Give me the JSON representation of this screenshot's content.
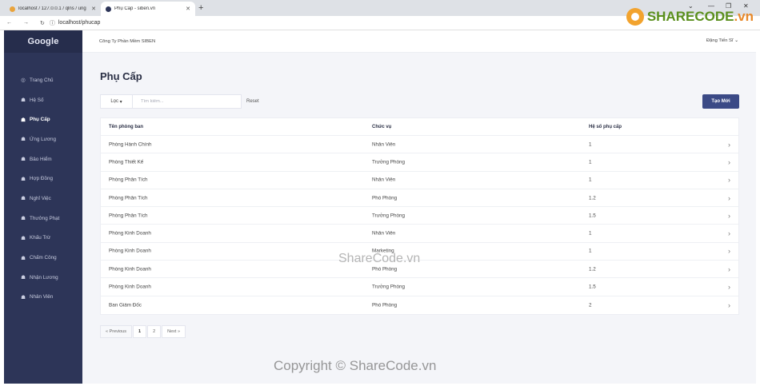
{
  "browser": {
    "tabs": [
      {
        "title": "localhost / 127.0.0.1 / qlns / ung"
      },
      {
        "title": "Phụ Cấp - siben.vn"
      }
    ],
    "new_tab": "+",
    "url": "localhost/phucap"
  },
  "sidebar": {
    "logo": "Google",
    "items": [
      {
        "label": "Trang Chủ"
      },
      {
        "label": "Hệ Số"
      },
      {
        "label": "Phụ Cấp"
      },
      {
        "label": "Ứng Lương"
      },
      {
        "label": "Bảo Hiểm"
      },
      {
        "label": "Hợp Đồng"
      },
      {
        "label": "Nghỉ Việc"
      },
      {
        "label": "Thưởng Phạt"
      },
      {
        "label": "Khấu Trừ"
      },
      {
        "label": "Chấm Công"
      },
      {
        "label": "Nhận Lương"
      },
      {
        "label": "Nhân Viên"
      }
    ]
  },
  "topbar": {
    "company": "Công Ty Phần Mềm SIBEN",
    "user": "Đặng Tiến Sĩ"
  },
  "main": {
    "title": "Phụ Cấp",
    "filter_label": "Lọc",
    "search_placeholder": "Tìm kiếm...",
    "reset_label": "Reset",
    "create_label": "Tạo Mới"
  },
  "table": {
    "headers": [
      "Tên phòng ban",
      "Chức vụ",
      "Hệ số phụ cấp"
    ],
    "rows": [
      [
        "Phòng Hành Chính",
        "Nhân Viên",
        "1"
      ],
      [
        "Phòng Thiết Kế",
        "Trưởng Phòng",
        "1"
      ],
      [
        "Phòng Phân Tích",
        "Nhân Viên",
        "1"
      ],
      [
        "Phòng Phân Tích",
        "Phó Phòng",
        "1.2"
      ],
      [
        "Phòng Phân Tích",
        "Trưởng Phòng",
        "1.5"
      ],
      [
        "Phòng Kinh Doanh",
        "Nhân Viên",
        "1"
      ],
      [
        "Phòng Kinh Doanh",
        "Marketing",
        "1"
      ],
      [
        "Phòng Kinh Doanh",
        "Phó Phòng",
        "1.2"
      ],
      [
        "Phòng Kinh Doanh",
        "Trưởng Phòng",
        "1.5"
      ],
      [
        "Ban Giám Đốc",
        "Phó Phòng",
        "2"
      ]
    ]
  },
  "pagination": {
    "prev": "« Previous",
    "pages": [
      "1",
      "2"
    ],
    "next": "Next »"
  },
  "watermarks": {
    "logo_text_a": "SHARECODE",
    "logo_text_b": ".vn",
    "center": "ShareCode.vn",
    "bottom": "Copyright © ShareCode.vn"
  }
}
